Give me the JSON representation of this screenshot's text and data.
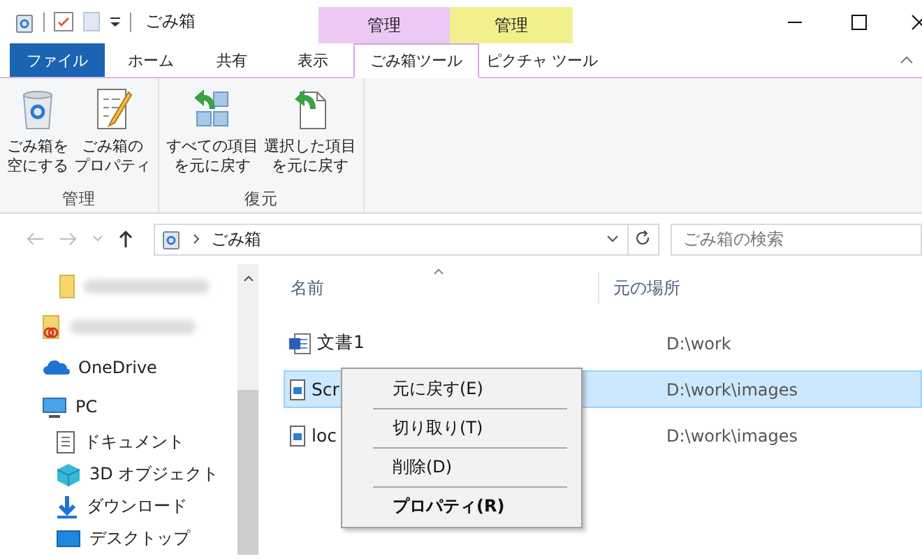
{
  "window": {
    "title": "ごみ箱"
  },
  "context_tabs": [
    {
      "label": "管理",
      "color": "#ecc9f5"
    },
    {
      "label": "管理",
      "color": "#f2f08c"
    }
  ],
  "ribbon_tabs": [
    {
      "label": "ファイル",
      "kind": "file",
      "selected": false
    },
    {
      "label": "ホーム",
      "kind": "plain",
      "selected": false
    },
    {
      "label": "共有",
      "kind": "plain",
      "selected": false
    },
    {
      "label": "表示",
      "kind": "plain",
      "selected": false
    },
    {
      "label": "ごみ箱ツール",
      "kind": "context",
      "selected": true
    },
    {
      "label": "ピクチャ ツール",
      "kind": "context",
      "selected": false
    }
  ],
  "ribbon_groups": [
    {
      "label": "管理",
      "buttons": [
        {
          "lines": [
            "ごみ箱を",
            "空にする"
          ],
          "kind": "bin"
        },
        {
          "lines": [
            "ごみ箱の",
            "プロパティ"
          ],
          "kind": "properties"
        }
      ]
    },
    {
      "label": "復元",
      "buttons": [
        {
          "lines": [
            "すべての項目",
            "を元に戻す"
          ],
          "kind": "restore-all"
        },
        {
          "lines": [
            "選択した項目",
            "を元に戻す"
          ],
          "kind": "restore-selected"
        }
      ]
    }
  ],
  "address": {
    "path": "ごみ箱"
  },
  "search": {
    "placeholder": "ごみ箱の検索"
  },
  "nav": [
    {
      "kind": "folder-blurred"
    },
    {
      "kind": "cloud-folder-blurred"
    },
    {
      "kind": "onedrive",
      "label": "OneDrive"
    },
    {
      "kind": "pc",
      "label": "PC",
      "children": [
        {
          "kind": "documents",
          "label": "ドキュメント"
        },
        {
          "kind": "objects3d",
          "label": "3D オブジェクト"
        },
        {
          "kind": "downloads",
          "label": "ダウンロード"
        },
        {
          "kind": "desktop",
          "label": "デスクトップ"
        }
      ]
    }
  ],
  "columns": [
    "名前",
    "元の場所"
  ],
  "rows": [
    {
      "name": "文書1",
      "location": "D:\\work",
      "kind": "word",
      "selected": false
    },
    {
      "name": "Scr",
      "location": "D:\\work\\images",
      "kind": "image",
      "selected": true
    },
    {
      "name": "loc",
      "location": "D:\\work\\images",
      "kind": "image",
      "selected": false
    }
  ],
  "context_menu": [
    {
      "label": "元に戻す(E)",
      "bold": false
    },
    {
      "label": "切り取り(T)",
      "bold": false
    },
    {
      "label": "削除(D)",
      "bold": false
    },
    {
      "label": "プロパティ(R)",
      "bold": true
    }
  ]
}
